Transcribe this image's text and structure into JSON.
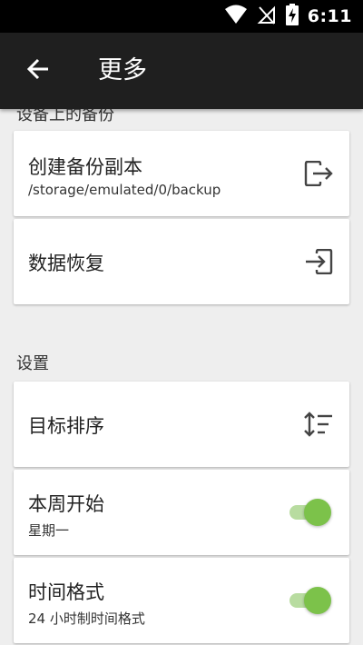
{
  "status_bar": {
    "time": "6:11",
    "icons": [
      "wifi-icon",
      "signal-off-icon",
      "battery-charging-icon"
    ]
  },
  "app_bar": {
    "title": "更多",
    "back_icon": "arrow-left-icon"
  },
  "backup_section": {
    "header": "设备上的备份",
    "items": [
      {
        "title": "创建备份副本",
        "subtitle": "/storage/emulated/0/backup",
        "icon": "export-icon"
      },
      {
        "title": "数据恢复",
        "icon": "import-icon"
      }
    ]
  },
  "settings_section": {
    "header": "设置",
    "items": [
      {
        "title": "目标排序",
        "icon": "sort-icon"
      },
      {
        "title": "本周开始",
        "subtitle": "星期一",
        "toggle_on": true
      },
      {
        "title": "时间格式",
        "subtitle": "24 小时制时间格式",
        "toggle_on": true
      }
    ]
  },
  "colors": {
    "app_bar": "#1f1f1f",
    "accent_green": "#7cc24a",
    "background": "#eeeeee"
  }
}
